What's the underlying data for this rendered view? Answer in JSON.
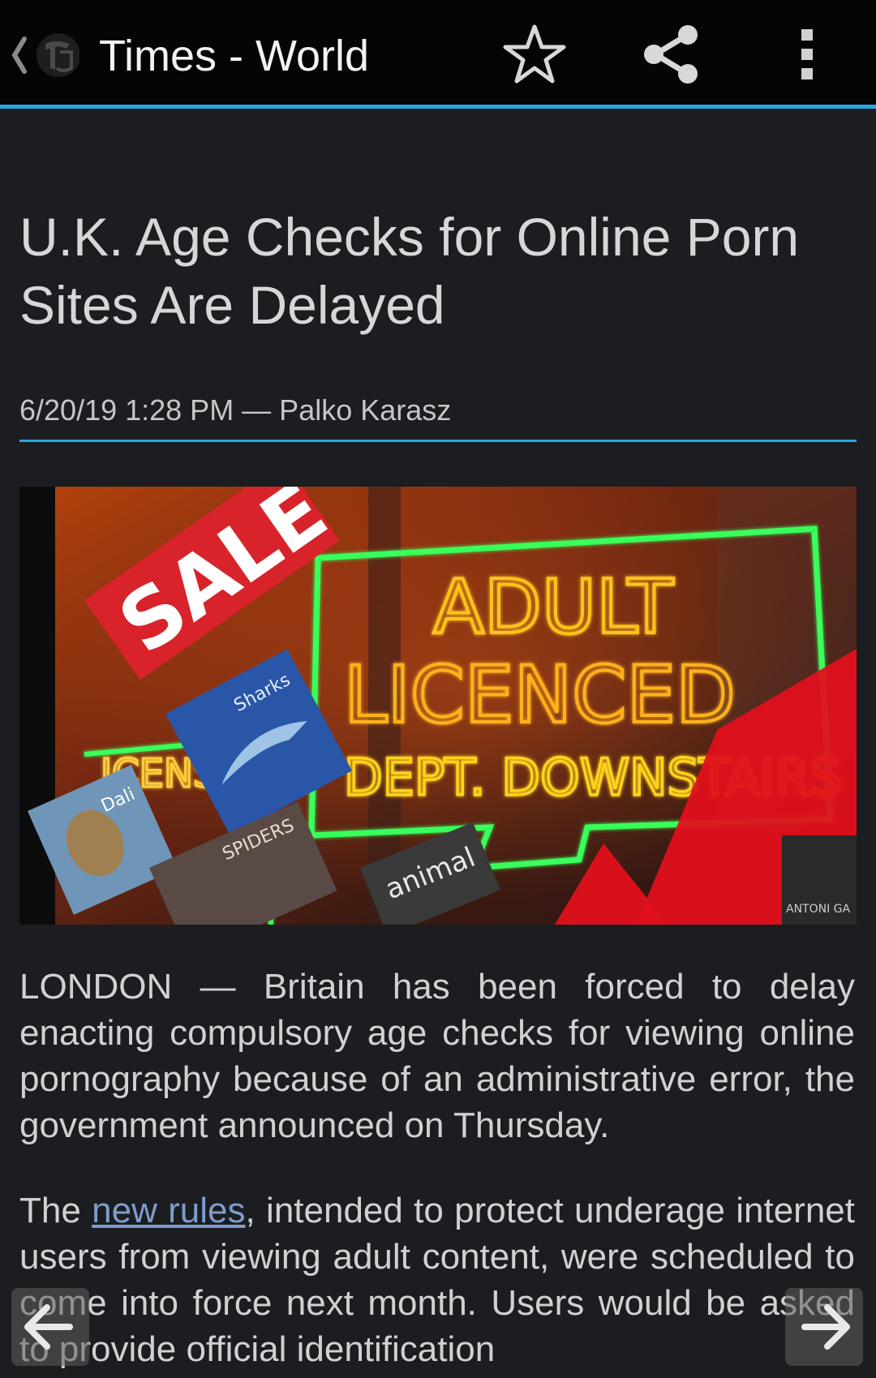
{
  "actionbar": {
    "title": "Times - World",
    "back_icon": "back-chevron-icon",
    "logo_icon": "nyt-logo-icon",
    "star_icon": "star-outline-icon",
    "share_icon": "share-icon",
    "more_icon": "overflow-menu-icon",
    "accent_color": "#2ba8e0"
  },
  "article": {
    "headline": "U.K. Age Checks for Online Porn Sites Are Delayed",
    "meta": "6/20/19 1:28 PM — Palko Karasz",
    "image_text": {
      "sale_sign": "SALE",
      "neon_line1": "ADULT",
      "neon_line2": "LICENCED",
      "neon_line3": "DEPT. DOWNSTAIRS",
      "book1": "Sharks",
      "book2": "Dali",
      "book3": "SPIDERS",
      "book4": "animal",
      "neon_left": "ICENSE",
      "corner_label": "ANTONI GA"
    },
    "paragraph1": "LONDON — Britain has been forced to delay enacting compulsory age checks for viewing online pornography because of an administrative error, the government announced on Thursday.",
    "paragraph2_start": "The ",
    "paragraph2_link": "new rules",
    "paragraph2_rest": ", intended to protect underage internet users from viewing adult content, were scheduled to come into force next month. Users would be asked to provide official identification"
  },
  "navigation": {
    "prev_icon": "arrow-left-icon",
    "next_icon": "arrow-right-icon"
  }
}
